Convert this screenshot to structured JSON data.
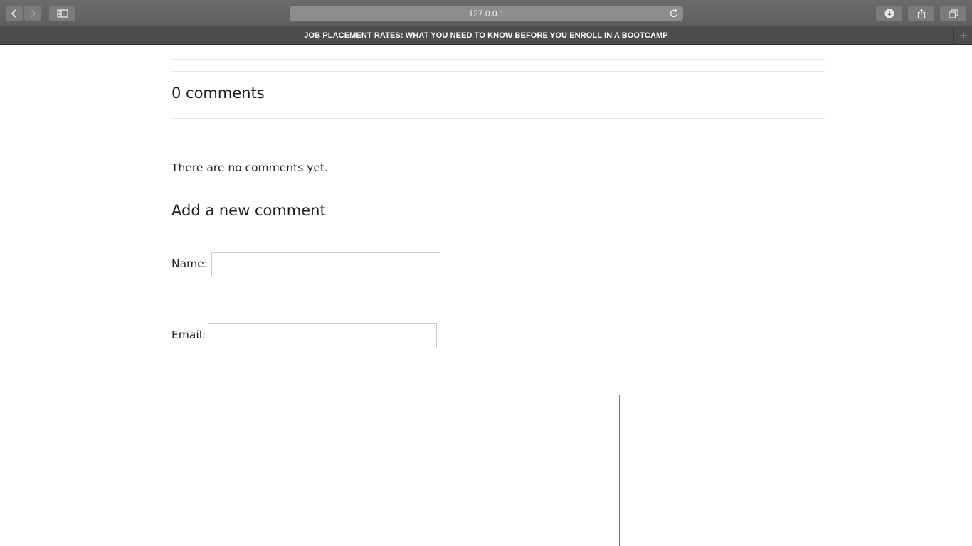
{
  "browser": {
    "url": "127.0.0.1",
    "tab_title": "JOB PLACEMENT RATES: WHAT YOU NEED TO KNOW BEFORE YOU ENROLL IN A BOOTCAMP",
    "icons": {
      "back": "chevron-left-icon",
      "forward": "chevron-right-icon",
      "sidebar": "sidebar-icon",
      "reload": "reload-icon",
      "downloads": "download-icon",
      "share": "share-icon",
      "tabs": "tabs-overview-icon",
      "new_tab": "plus-icon"
    }
  },
  "comments": {
    "count_heading": "0 comments",
    "empty_message": "There are no comments yet."
  },
  "form": {
    "heading": "Add a new comment",
    "name_label": "Name:",
    "name_value": "",
    "email_label": "Email:",
    "email_value": "",
    "comment_value": ""
  },
  "colors": {
    "toolbar": "#666666",
    "tab_bar": "#4d4d4d",
    "page_text": "#1e1e1e",
    "divider": "#e3e3e3"
  }
}
